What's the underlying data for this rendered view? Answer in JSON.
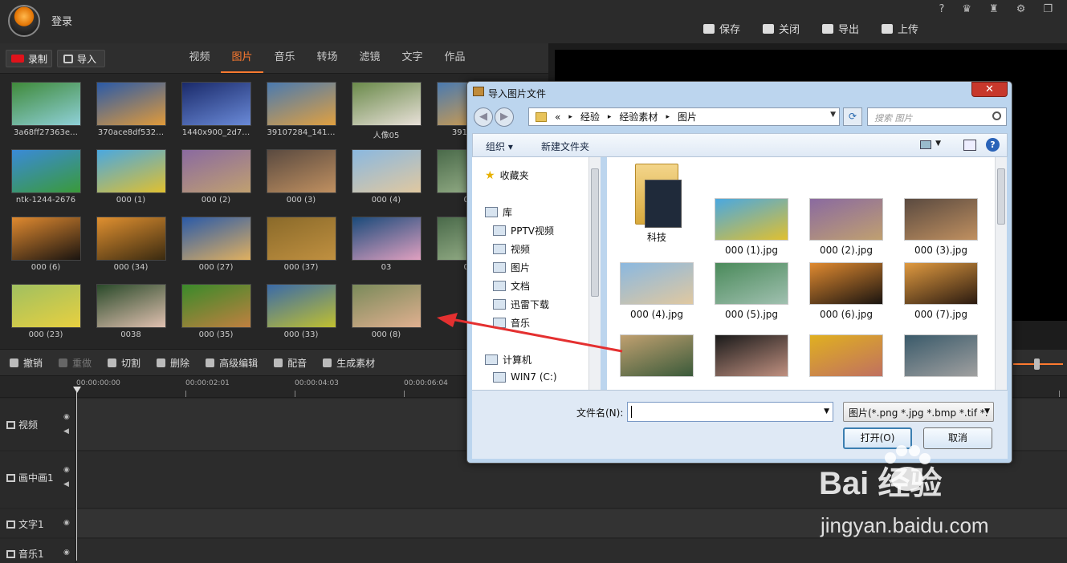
{
  "header": {
    "login": "登录"
  },
  "actions": [
    {
      "label": "保存"
    },
    {
      "label": "关闭"
    },
    {
      "label": "导出"
    },
    {
      "label": "上传"
    }
  ],
  "library": {
    "record": "录制",
    "import": "导入",
    "tabs": [
      "视频",
      "图片",
      "音乐",
      "转场",
      "滤镜",
      "文字",
      "作品"
    ],
    "active_tab": "图片",
    "items": [
      {
        "caption": "3a68ff27363e…",
        "color1": "#3f8a3a",
        "color2": "#8fd0d8"
      },
      {
        "caption": "370ace8df532…",
        "color1": "#2a5aa8",
        "color2": "#e09a3a"
      },
      {
        "caption": "1440x900_2d7…",
        "color1": "#1a2a6a",
        "color2": "#6a8ad8"
      },
      {
        "caption": "39107284_141…",
        "color1": "#4a7ab0",
        "color2": "#e0a040"
      },
      {
        "caption": "人像05",
        "color1": "#6a8a4a",
        "color2": "#e8e0d8"
      },
      {
        "caption": "391072…",
        "color1": "#4a7ab0",
        "color2": "#e0a040"
      },
      {
        "caption": "ntk-1244-2676",
        "color1": "#3a8ad8",
        "color2": "#3a9a3a"
      },
      {
        "caption": "000 (1)",
        "color1": "#4aa8e0",
        "color2": "#e0c030"
      },
      {
        "caption": "000 (2)",
        "color1": "#8a6aa0",
        "color2": "#c0a070"
      },
      {
        "caption": "000 (3)",
        "color1": "#5a4a40",
        "color2": "#c09060"
      },
      {
        "caption": "000 (4)",
        "color1": "#8ab8e0",
        "color2": "#e0c8a0"
      },
      {
        "caption": "000",
        "color1": "#4a6a4a",
        "color2": "#a0b890"
      },
      {
        "caption": "000 (6)",
        "color1": "#e08a30",
        "color2": "#1a1410"
      },
      {
        "caption": "000 (34)",
        "color1": "#e09030",
        "color2": "#3a2a10"
      },
      {
        "caption": "000 (27)",
        "color1": "#2a5aa8",
        "color2": "#e0b060"
      },
      {
        "caption": "000 (37)",
        "color1": "#8a6a2a",
        "color2": "#c09040"
      },
      {
        "caption": "03",
        "color1": "#1a4a7a",
        "color2": "#e0a0c0"
      },
      {
        "caption": "000",
        "color1": "#4a6a4a",
        "color2": "#a0b890"
      },
      {
        "caption": "000 (23)",
        "color1": "#a0c060",
        "color2": "#e8d040"
      },
      {
        "caption": "0038",
        "color1": "#2a4a2a",
        "color2": "#e0c0b0"
      },
      {
        "caption": "000 (35)",
        "color1": "#3a8a2a",
        "color2": "#c08040"
      },
      {
        "caption": "000 (33)",
        "color1": "#3a6aa8",
        "color2": "#c0c030"
      },
      {
        "caption": "000 (8)",
        "color1": "#7a8a5a",
        "color2": "#e0b090"
      }
    ]
  },
  "editbar": {
    "tools": [
      {
        "label": "撤销",
        "disabled": false
      },
      {
        "label": "重做",
        "disabled": true
      },
      {
        "label": "切割",
        "disabled": false
      },
      {
        "label": "删除",
        "disabled": false
      },
      {
        "label": "高级编辑",
        "disabled": false
      },
      {
        "label": "配音",
        "disabled": false
      },
      {
        "label": "生成素材",
        "disabled": false
      }
    ]
  },
  "timeline": {
    "ticks": [
      "00:00:00:00",
      "00:00:02:01",
      "00:00:04:03",
      "00:00:06:04"
    ],
    "tracks": [
      {
        "label": "视频"
      },
      {
        "label": "画中画1"
      },
      {
        "label": "文字1"
      },
      {
        "label": "音乐1"
      }
    ]
  },
  "dialog": {
    "title": "导入图片文件",
    "close": "✕",
    "breadcrumb": [
      "«",
      "经验",
      "经验素材",
      "图片"
    ],
    "search_placeholder": "搜索 图片",
    "organize": "组织 ▾",
    "new_folder": "新建文件夹",
    "nav": {
      "favorites": "收藏夹",
      "libraries": "库",
      "lib_items": [
        "PPTV视频",
        "视频",
        "图片",
        "文档",
        "迅雷下载",
        "音乐"
      ],
      "computer": "计算机",
      "drive": "WIN7 (C:)"
    },
    "files": [
      {
        "name": "科技",
        "type": "folder"
      },
      {
        "name": "000 (1).jpg",
        "color1": "#4aa8e0",
        "color2": "#e0c030"
      },
      {
        "name": "000 (2).jpg",
        "color1": "#8a6aa0",
        "color2": "#c0a070"
      },
      {
        "name": "000 (3).jpg",
        "color1": "#5a4a40",
        "color2": "#c09060"
      },
      {
        "name": "000 (4).jpg",
        "color1": "#8ab8e0",
        "color2": "#e0c8a0"
      },
      {
        "name": "000 (5).jpg",
        "color1": "#4a8a5a",
        "color2": "#a0c0b0"
      },
      {
        "name": "000 (6).jpg",
        "color1": "#e08a30",
        "color2": "#1a1410"
      },
      {
        "name": "000 (7).jpg",
        "color1": "#e09a40",
        "color2": "#2a1a10"
      },
      {
        "name": "",
        "color1": "#c0a070",
        "color2": "#3a5a3a"
      },
      {
        "name": "",
        "color1": "#1a1a1a",
        "color2": "#c09080"
      },
      {
        "name": "",
        "color1": "#e0b020",
        "color2": "#c07060"
      },
      {
        "name": "",
        "color1": "#3a5a6a",
        "color2": "#a0a0a0"
      }
    ],
    "filename_label": "文件名(N):",
    "filename_value": "",
    "filetype": "图片(*.png *.jpg *.bmp *.tif *.",
    "open": "打开(O)",
    "cancel": "取消"
  },
  "watermark": {
    "brand": "Bai 经验",
    "url": "jingyan.baidu.com"
  }
}
